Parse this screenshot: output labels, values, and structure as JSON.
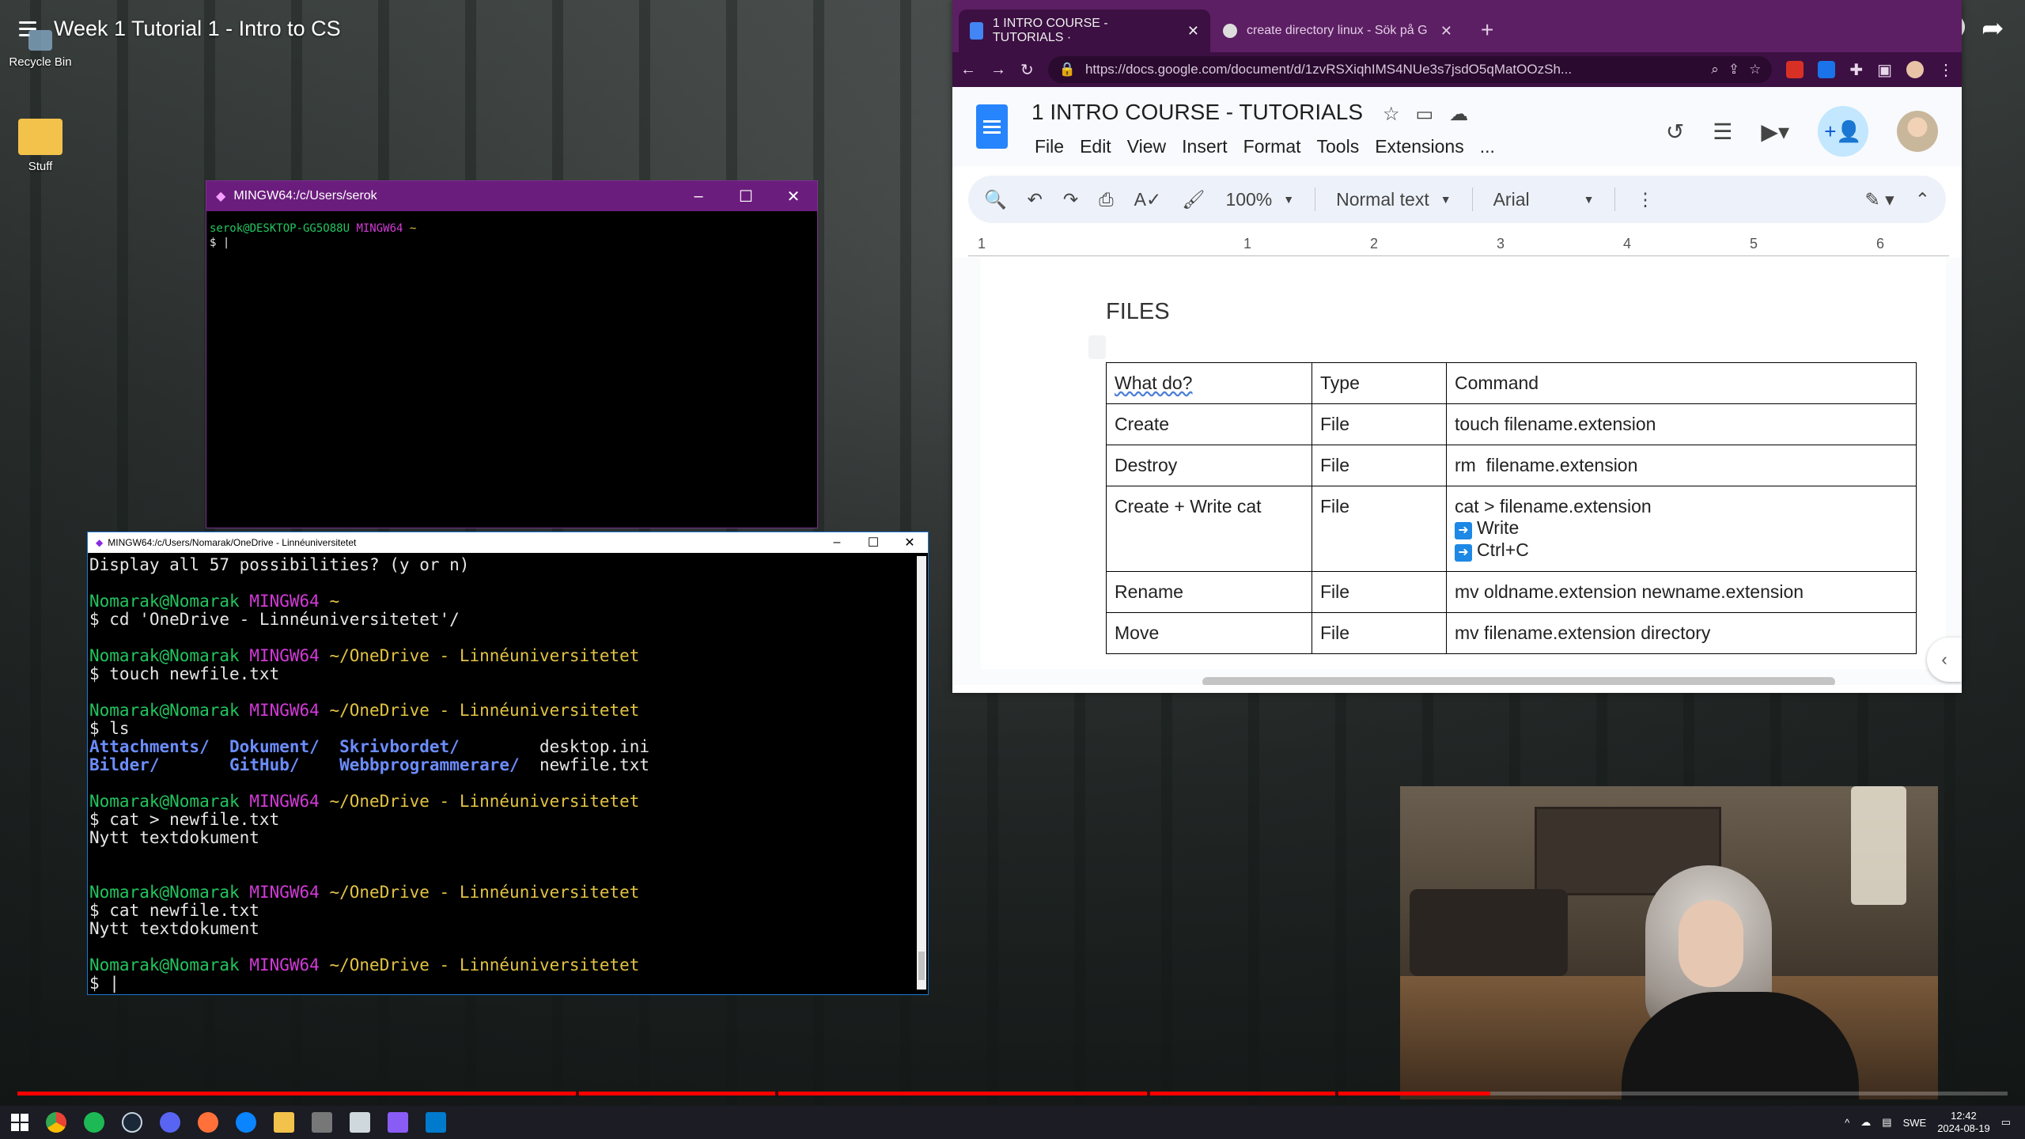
{
  "video": {
    "title": "Week 1 Tutorial 1 - Intro to CS",
    "progress_fraction": 0.74
  },
  "desktop": {
    "icons": [
      {
        "label": "Recycle Bin"
      },
      {
        "label": "Stuff"
      }
    ]
  },
  "term_small": {
    "title": "MINGW64:/c/Users/serok",
    "prompt_user": "serok@DESKTOP-GG5O88U",
    "prompt_env": "MINGW64",
    "prompt_path": "~",
    "prompt_symbol": "$ |"
  },
  "term_big": {
    "title": "MINGW64:/c/Users/Nomarak/OneDrive - Linnéuniversitetet",
    "line_possibilities": "Display all 57 possibilities? (y or n)",
    "user": "Nomarak@Nomarak",
    "env": "MINGW64",
    "home": "~",
    "path": "~/OneDrive - Linnéuniversitetet",
    "cmd_cd": "$ cd 'OneDrive - Linnéuniversitetet'/",
    "cmd_touch": "$ touch newfile.txt",
    "cmd_ls": "$ ls",
    "ls_dirs_row1": [
      "Attachments/",
      "Dokument/",
      "Skrivbordet/"
    ],
    "ls_file_row1": "desktop.ini",
    "ls_dirs_row2": [
      "Bilder/",
      "GitHub/",
      "Webbprogrammerare/"
    ],
    "ls_file_row2": "newfile.txt",
    "cmd_cat_write": "$ cat > newfile.txt",
    "out_write": "Nytt textdokument",
    "cmd_cat_read": "$ cat newfile.txt",
    "out_read": "Nytt textdokument",
    "cursor": "$ |"
  },
  "browser": {
    "tabs": [
      {
        "label": "1 INTRO COURSE - TUTORIALS ·",
        "active": true
      },
      {
        "label": "create directory linux - Sök på G",
        "active": false
      }
    ],
    "url": "https://docs.google.com/document/d/1zvRSXiqhIMS4NUe3s7jsdO5qMatOOzSh..."
  },
  "docs": {
    "title": "1 INTRO COURSE - TUTORIALS",
    "menu": [
      "File",
      "Edit",
      "View",
      "Insert",
      "Format",
      "Tools",
      "Extensions",
      "..."
    ],
    "zoom": "100%",
    "style": "Normal text",
    "font": "Arial",
    "ruler": [
      "1",
      "1",
      "2",
      "3",
      "4",
      "5",
      "6"
    ],
    "heading": "FILES",
    "table": {
      "header": [
        "What do?",
        "Type",
        "Command"
      ],
      "rows": [
        {
          "what": "Create",
          "type": "File",
          "command": "touch filename.extension"
        },
        {
          "what": "Destroy",
          "type": "File",
          "command": "rm  filename.extension"
        },
        {
          "what": "Create + Write cat",
          "type": "File",
          "command": "cat > filename.extension",
          "step1": "Write",
          "step2": "Ctrl+C"
        },
        {
          "what": "Rename",
          "type": "File",
          "command": "mv oldname.extension newname.extension"
        },
        {
          "what": "Move",
          "type": "File",
          "command": "mv filename.extension directory"
        }
      ]
    }
  },
  "taskbar": {
    "lang": "SWE",
    "time": "12:42",
    "date": "2024-08-19"
  }
}
